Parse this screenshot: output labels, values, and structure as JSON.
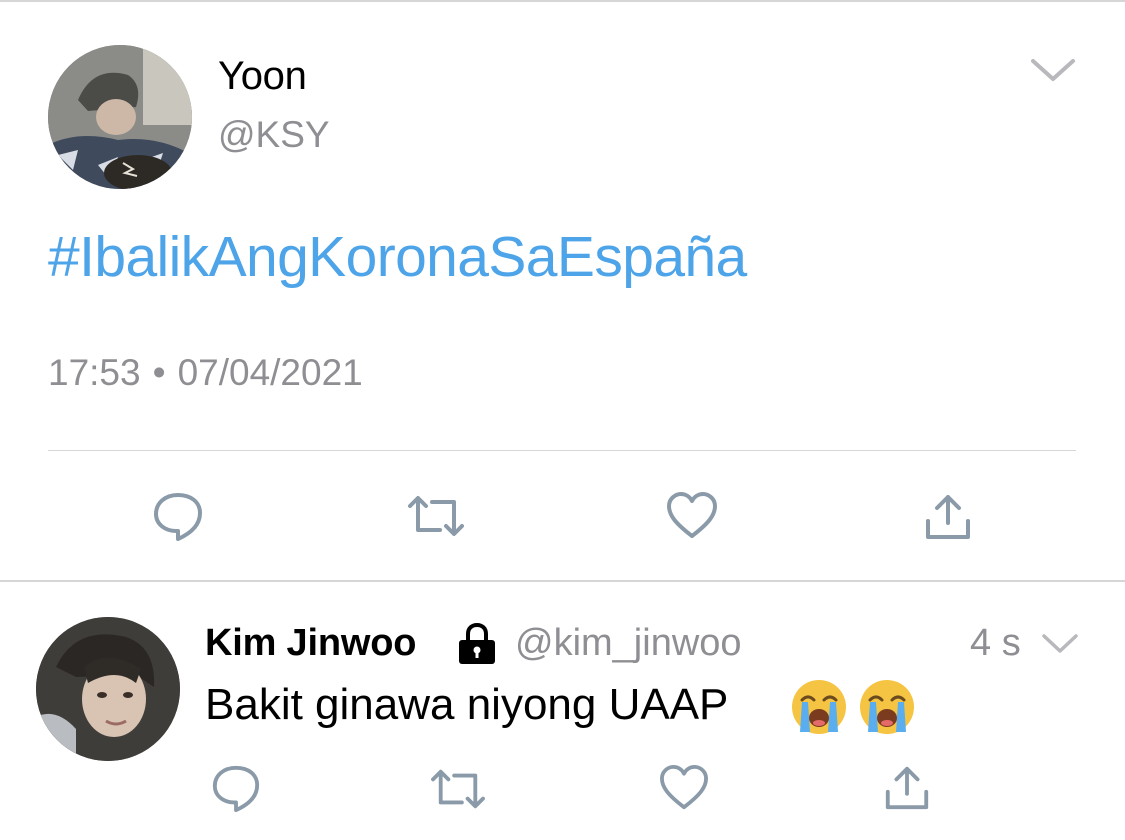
{
  "main_tweet": {
    "name": "Yoon",
    "handle": "@KSY",
    "hashtag": "#IbalikAngKoronaSaEspaña",
    "time": "17:53",
    "separator": "•",
    "date": "07/04/2021"
  },
  "reply": {
    "name": "Kim Jinwoo",
    "handle": "@kim_jinwoo",
    "time_ago": "4 s",
    "text": "Bakit ginawa niyong UAAP",
    "emojis": [
      "loudly-crying-face",
      "loudly-crying-face"
    ]
  },
  "actions": [
    "reply-icon",
    "retweet-icon",
    "like-icon",
    "share-icon"
  ],
  "colors": {
    "hashtag": "#4ea4e8",
    "secondary_text": "#8e8e93",
    "icon": "#8a9aa8",
    "divider": "#d6d6d6"
  }
}
